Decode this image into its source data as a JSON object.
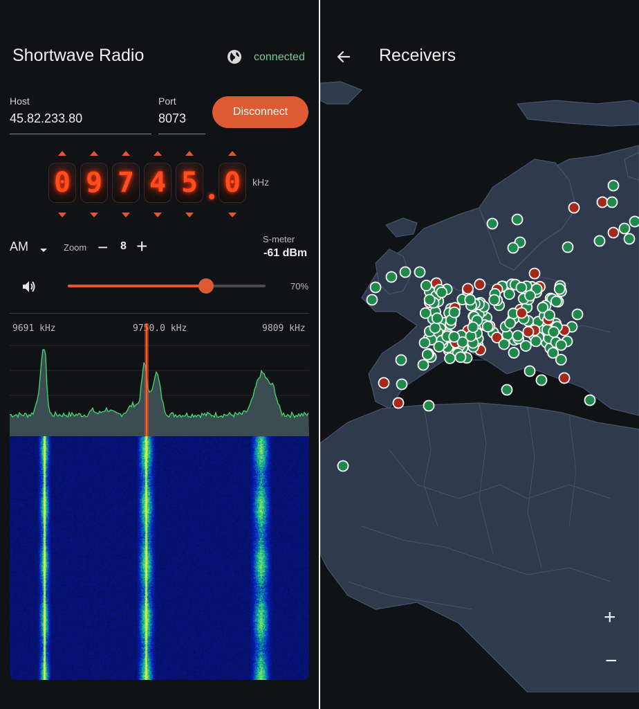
{
  "left": {
    "app_title": "Shortwave Radio",
    "status": "connected",
    "host": {
      "label": "Host",
      "value": "45.82.233.80"
    },
    "port": {
      "label": "Port",
      "value": "8073"
    },
    "disconnect_label": "Disconnect",
    "frequency": {
      "digits": [
        "0",
        "9",
        "7",
        "4",
        "5",
        "0"
      ],
      "unit": "kHz"
    },
    "mode": "AM",
    "zoom": {
      "label": "Zoom",
      "minus": "−",
      "value": "8",
      "plus": "+"
    },
    "smeter": {
      "label": "S-meter",
      "value": "-61 dBm"
    },
    "volume": {
      "percent_label": "70%",
      "level": 0.7
    },
    "spectrum": {
      "left_label": "9691 kHz",
      "center_label": "9750.0 kHz",
      "right_label": "9809 kHz"
    }
  },
  "right": {
    "title": "Receivers",
    "zoom_in": "+",
    "zoom_out": "−"
  },
  "colors": {
    "accent": "#dd5a33",
    "status_connected": "#6fcf97",
    "receiver_online": "#1f8a4c",
    "receiver_offline": "#a32a1b"
  }
}
